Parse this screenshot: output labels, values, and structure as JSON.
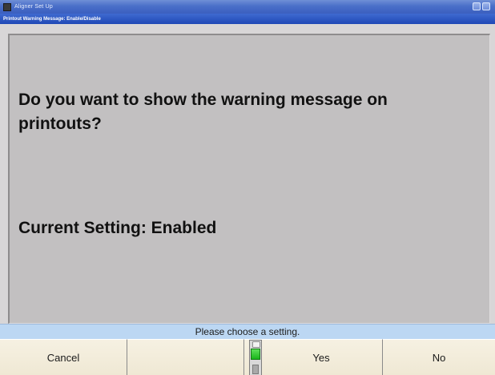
{
  "window": {
    "title": "Aligner Set Up",
    "subtitle": "Printout Warning Message: Enable/Disable"
  },
  "content": {
    "question": "Do you want to show the warning message on printouts?",
    "current_setting": "Current Setting: Enabled"
  },
  "status": {
    "message": "Please choose a setting."
  },
  "keys": {
    "cancel": "Cancel",
    "blank": "",
    "yes": "Yes",
    "no": "No"
  },
  "colors": {
    "titlebar": "#4a6fc9",
    "panel": "#c2c0c1",
    "status_bar": "#bcd7f3",
    "key_face": "#f6f1e2",
    "indicator_active": "#19b51a"
  },
  "icons": {
    "app": "app-icon",
    "minimize": "minimize-icon",
    "maximize": "maximize-icon",
    "selection_indicator": "selection-indicator-icon"
  }
}
